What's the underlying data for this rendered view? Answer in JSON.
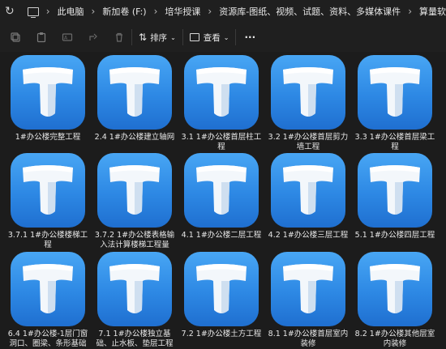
{
  "address": {
    "segments": [
      "此电脑",
      "新加卷 (F:)",
      "培华授课",
      "资源库-图纸、视频、试题、资料、多媒体课件",
      "算量软"
    ]
  },
  "toolbar": {
    "sort_label": "排序",
    "view_label": "查看",
    "more_label": "···"
  },
  "files": [
    {
      "name": "1#办公楼完整工程"
    },
    {
      "name": "2.4 1#办公楼建立轴网"
    },
    {
      "name": "3.1 1#办公楼首层柱工程"
    },
    {
      "name": "3.2 1#办公楼首层剪力墙工程"
    },
    {
      "name": "3.3 1#办公楼首层梁工程"
    },
    {
      "name": "3.7.1 1#办公楼楼梯工程"
    },
    {
      "name": "3.7.2 1#办公楼表格输入法计算楼梯工程量"
    },
    {
      "name": "4.1 1#办公楼二层工程"
    },
    {
      "name": "4.2 1#办公楼三层工程"
    },
    {
      "name": "5.1 1#办公楼四层工程"
    },
    {
      "name": "6.4 1#办公楼-1层门窗洞口、圈梁、条形基础"
    },
    {
      "name": "7.1 1#办公楼独立基础、止水板、垫层工程"
    },
    {
      "name": "7.2 1#办公楼土方工程"
    },
    {
      "name": "8.1 1#办公楼首层室内装修"
    },
    {
      "name": "8.2 1#办公楼其他层室内装修"
    }
  ]
}
